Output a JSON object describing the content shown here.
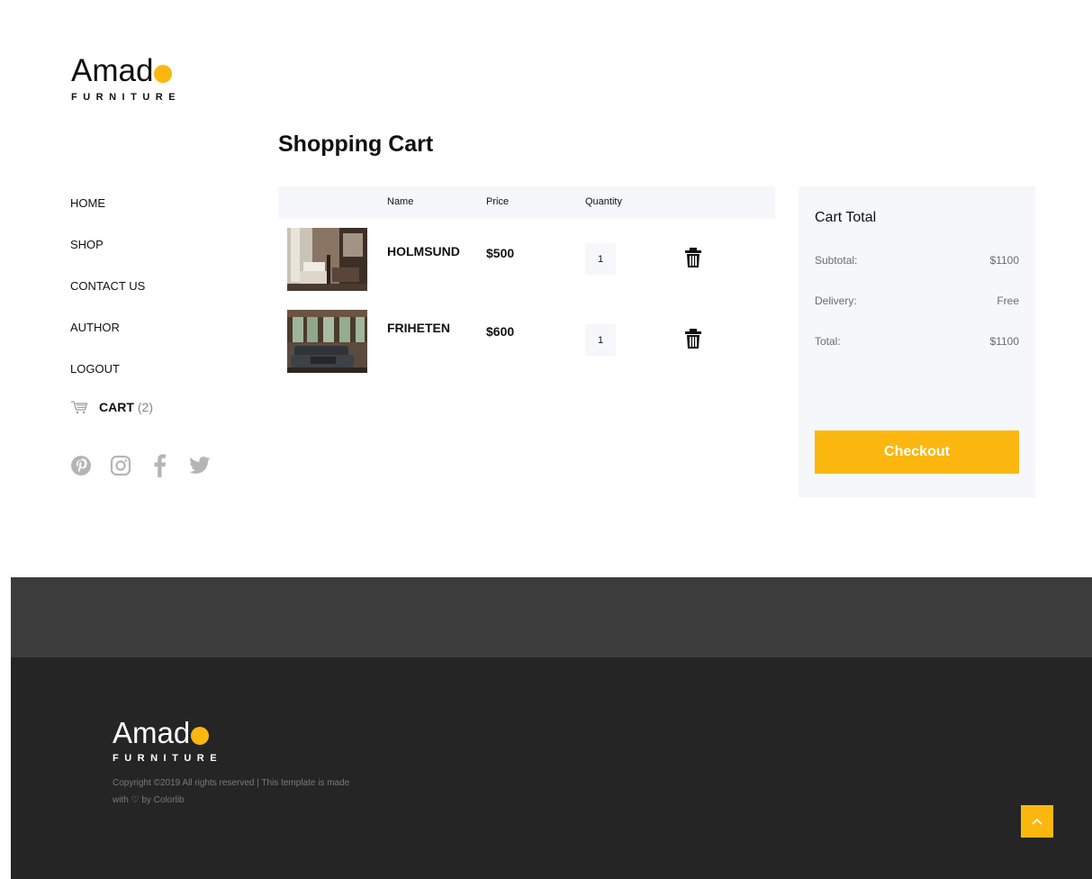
{
  "brand": {
    "name": "Amad",
    "subtitle": "FURNITURE",
    "accent_color": "#fbb710"
  },
  "nav": {
    "items": [
      {
        "label": "HOME"
      },
      {
        "label": "SHOP"
      },
      {
        "label": "CONTACT US"
      },
      {
        "label": "AUTHOR"
      },
      {
        "label": "LOGOUT"
      }
    ],
    "cart": {
      "label": "CART",
      "count": "(2)",
      "icon": "cart-icon"
    },
    "social": [
      "pinterest-icon",
      "instagram-icon",
      "facebook-icon",
      "twitter-icon"
    ]
  },
  "cart": {
    "title": "Shopping Cart",
    "columns": {
      "name": "Name",
      "price": "Price",
      "quantity": "Quantity"
    },
    "items": [
      {
        "name": "HOLMSUND",
        "price": "$500",
        "quantity": "1"
      },
      {
        "name": "FRIHETEN",
        "price": "$600",
        "quantity": "1"
      }
    ]
  },
  "summary": {
    "title": "Cart Total",
    "subtotal_label": "Subtotal:",
    "subtotal_value": "$1100",
    "delivery_label": "Delivery:",
    "delivery_value": "Free",
    "total_label": "Total:",
    "total_value": "$1100",
    "checkout_label": "Checkout"
  },
  "footer": {
    "copyright_line1": "Copyright ©2019 All rights reserved | This template is made",
    "copyright_line2_pre": "with",
    "copyright_line2_post": "by Colorlib",
    "top_band_color": "#3c3c3c",
    "main_color": "#252525"
  }
}
